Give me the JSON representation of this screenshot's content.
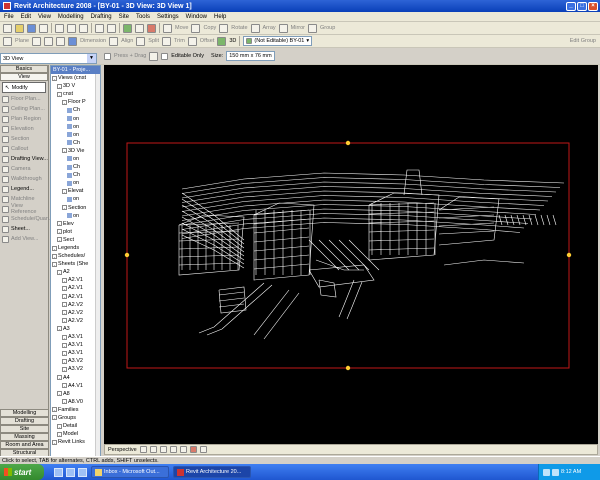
{
  "window": {
    "title": "Revit Architecture 2008 - [BY-01 - 3D View: 3D View 1]"
  },
  "menu": [
    "File",
    "Edit",
    "View",
    "Modelling",
    "Drafting",
    "Site",
    "Tools",
    "Settings",
    "Window",
    "Help"
  ],
  "toolbar2": {
    "move": "Move",
    "copy": "Copy",
    "rotate": "Rotate",
    "array": "Array",
    "mirror": "Mirror",
    "group": "Group",
    "threeD": "3D",
    "workset": "(Not Editable) BY-01"
  },
  "toolbar3": {
    "plane": "Plane",
    "dimension": "Dimension",
    "align": "Align",
    "split": "Split",
    "trim": "Trim",
    "offset": "Offset",
    "editgroup": "Edit Group"
  },
  "optionsbar": {
    "press_drag": "Press + Drag",
    "editable_only": "Editable Only",
    "size_label": "Size:",
    "size_value": "150 mm x 76 mm"
  },
  "view_selector": "3D View",
  "left_panel": {
    "tabs_top": [
      "Basics",
      "View"
    ],
    "modify": "Modify",
    "items": [
      {
        "label": "Floor Plan...",
        "enabled": false
      },
      {
        "label": "Ceiling Plan...",
        "enabled": false
      },
      {
        "label": "Plan Region",
        "enabled": false
      },
      {
        "label": "Elevation",
        "enabled": false
      },
      {
        "label": "Section",
        "enabled": false
      },
      {
        "label": "Callout",
        "enabled": false
      },
      {
        "label": "Drafting View...",
        "enabled": true
      },
      {
        "label": "Camera",
        "enabled": false
      },
      {
        "label": "Walkthrough",
        "enabled": false
      },
      {
        "label": "Legend...",
        "enabled": true
      },
      {
        "label": "Matchline",
        "enabled": false
      },
      {
        "label": "View Reference",
        "enabled": false
      },
      {
        "label": "Schedule/Quan...",
        "enabled": false
      },
      {
        "label": "Sheet...",
        "enabled": true
      },
      {
        "label": "Add View...",
        "enabled": false
      }
    ],
    "tabs_bottom": [
      "Modelling",
      "Drafting",
      "Site",
      "Massing",
      "Room and Area",
      "Structural"
    ]
  },
  "browser": {
    "title": "BY-01 - Proje...",
    "rows": [
      {
        "indent": 0,
        "label": "Views (cnst"
      },
      {
        "indent": 1,
        "label": "3D V"
      },
      {
        "indent": 1,
        "label": "cnst"
      },
      {
        "indent": 2,
        "label": "Floor P"
      },
      {
        "indent": 3,
        "label": "Ch"
      },
      {
        "indent": 3,
        "label": "on"
      },
      {
        "indent": 3,
        "label": "on"
      },
      {
        "indent": 3,
        "label": "on"
      },
      {
        "indent": 3,
        "label": "Ch"
      },
      {
        "indent": 2,
        "label": "3D Vie"
      },
      {
        "indent": 3,
        "label": "on"
      },
      {
        "indent": 3,
        "label": "Ch"
      },
      {
        "indent": 3,
        "label": "Ch"
      },
      {
        "indent": 3,
        "label": "on"
      },
      {
        "indent": 2,
        "label": "Elevat"
      },
      {
        "indent": 3,
        "label": "on"
      },
      {
        "indent": 2,
        "label": "Section"
      },
      {
        "indent": 3,
        "label": "on"
      },
      {
        "indent": 1,
        "label": "Elev"
      },
      {
        "indent": 1,
        "label": "plot"
      },
      {
        "indent": 1,
        "label": "Sect"
      },
      {
        "indent": 0,
        "label": "Legends"
      },
      {
        "indent": 0,
        "label": "Schedules/"
      },
      {
        "indent": 0,
        "label": "Sheets (She"
      },
      {
        "indent": 1,
        "label": "A2"
      },
      {
        "indent": 2,
        "label": "A2.V1"
      },
      {
        "indent": 2,
        "label": "A2.V1"
      },
      {
        "indent": 2,
        "label": "A2.V1"
      },
      {
        "indent": 2,
        "label": "A2.V2"
      },
      {
        "indent": 2,
        "label": "A2.V2"
      },
      {
        "indent": 2,
        "label": "A2.V2"
      },
      {
        "indent": 1,
        "label": "A3"
      },
      {
        "indent": 2,
        "label": "A3.V1"
      },
      {
        "indent": 2,
        "label": "A3.V1"
      },
      {
        "indent": 2,
        "label": "A3.V1"
      },
      {
        "indent": 2,
        "label": "A3.V2"
      },
      {
        "indent": 2,
        "label": "A3.V2"
      },
      {
        "indent": 1,
        "label": "A4"
      },
      {
        "indent": 2,
        "label": "A4.V1"
      },
      {
        "indent": 1,
        "label": "A8"
      },
      {
        "indent": 2,
        "label": "A8.V0"
      },
      {
        "indent": 0,
        "label": "Families"
      },
      {
        "indent": 0,
        "label": "Groups"
      },
      {
        "indent": 1,
        "label": "Detail"
      },
      {
        "indent": 1,
        "label": "Model"
      },
      {
        "indent": 0,
        "label": "Revit Links"
      }
    ]
  },
  "view_control": {
    "mode": "Perspective"
  },
  "status": "Click to select, TAB for alternates, CTRL adds, SHIFT unselects.",
  "taskbar": {
    "start": "start",
    "items": [
      "Inbox - Microsoft Out...",
      "Revit Architecture 20..."
    ],
    "clock": "8:12 AM"
  },
  "colors": {
    "crop_region": "#c01818",
    "grips": "#ffcc33",
    "model_lines": "#ffffff"
  }
}
